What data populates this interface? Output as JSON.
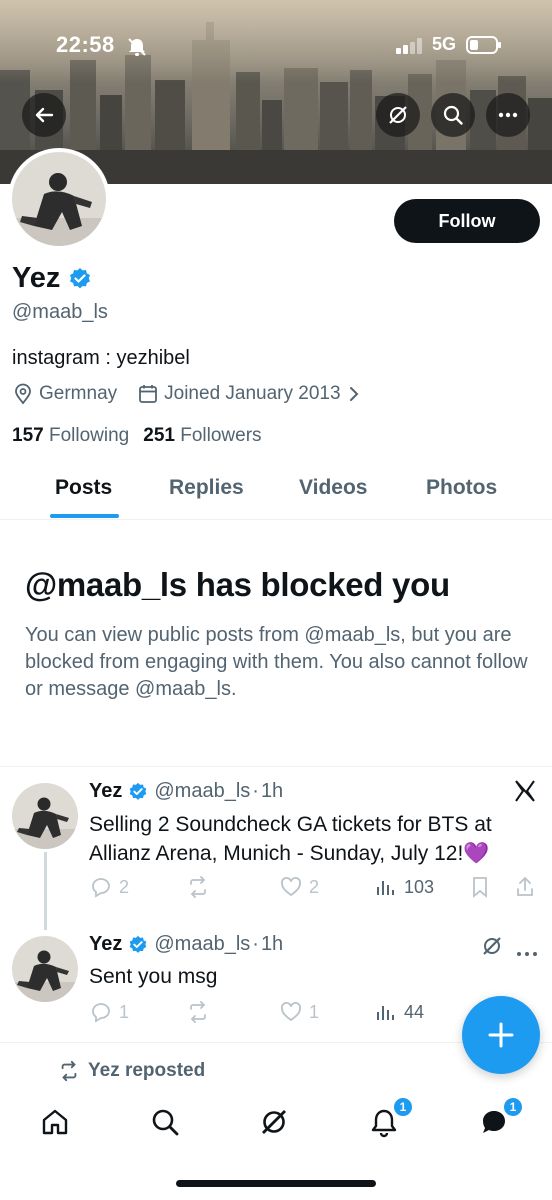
{
  "status_bar": {
    "time": "22:58",
    "network": "5G"
  },
  "profile": {
    "name": "Yez",
    "handle": "@maab_ls",
    "bio": "instagram : yezhibel",
    "location": "Germnay",
    "joined": "Joined January 2013",
    "following_count": "157",
    "following_label": "Following",
    "followers_count": "251",
    "followers_label": "Followers",
    "follow_label": "Follow"
  },
  "tabs": [
    {
      "label": "Posts"
    },
    {
      "label": "Replies"
    },
    {
      "label": "Videos"
    },
    {
      "label": "Photos"
    }
  ],
  "blocked": {
    "title": "@maab_ls has blocked you",
    "body": "You can view public posts from @maab_ls, but you are blocked from engaging with them. You also cannot follow or message @maab_ls."
  },
  "posts": [
    {
      "name": "Yez",
      "handle": "@maab_ls",
      "separator": "·",
      "time": "1h",
      "text": "Selling 2 Soundcheck GA tickets for BTS at Allianz Arena, Munich - Sunday, July 12!💜",
      "replies": "2",
      "reposts": "",
      "likes": "2",
      "views": "103"
    },
    {
      "name": "Yez",
      "handle": "@maab_ls",
      "separator": "·",
      "time": "1h",
      "text": "Sent you msg",
      "replies": "1",
      "reposts": "",
      "likes": "1",
      "views": "44"
    }
  ],
  "repost_label": "Yez reposted",
  "nav": {
    "notifications_badge": "1",
    "messages_badge": "1"
  },
  "colors": {
    "accent": "#1d9bf0",
    "text": "#0f1419",
    "muted": "#536471",
    "button": "#0f1419"
  },
  "icons": [
    "back-arrow-icon",
    "grok-icon",
    "search-icon",
    "more-icon",
    "verified-badge-icon",
    "location-icon",
    "calendar-icon",
    "chevron-right-icon",
    "x-logo-icon",
    "reply-icon",
    "repost-icon",
    "like-icon",
    "views-icon",
    "bookmark-icon",
    "share-icon",
    "compose-plus-icon",
    "home-icon",
    "notifications-icon",
    "messages-icon"
  ]
}
